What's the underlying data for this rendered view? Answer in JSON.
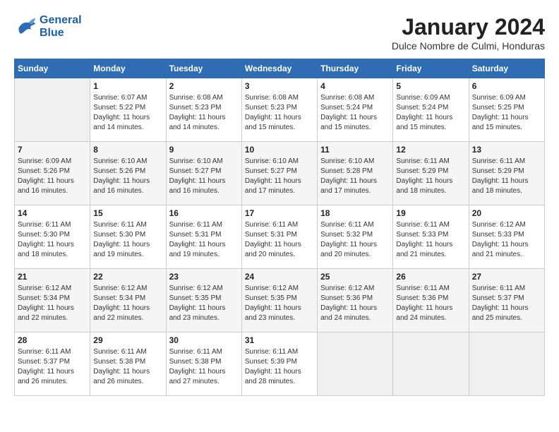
{
  "logo": {
    "line1": "General",
    "line2": "Blue"
  },
  "title": "January 2024",
  "location": "Dulce Nombre de Culmi, Honduras",
  "days_of_week": [
    "Sunday",
    "Monday",
    "Tuesday",
    "Wednesday",
    "Thursday",
    "Friday",
    "Saturday"
  ],
  "weeks": [
    [
      null,
      {
        "num": "1",
        "sunrise": "6:07 AM",
        "sunset": "5:22 PM",
        "daylight": "11 hours and 14 minutes."
      },
      {
        "num": "2",
        "sunrise": "6:08 AM",
        "sunset": "5:23 PM",
        "daylight": "11 hours and 14 minutes."
      },
      {
        "num": "3",
        "sunrise": "6:08 AM",
        "sunset": "5:23 PM",
        "daylight": "11 hours and 15 minutes."
      },
      {
        "num": "4",
        "sunrise": "6:08 AM",
        "sunset": "5:24 PM",
        "daylight": "11 hours and 15 minutes."
      },
      {
        "num": "5",
        "sunrise": "6:09 AM",
        "sunset": "5:24 PM",
        "daylight": "11 hours and 15 minutes."
      },
      {
        "num": "6",
        "sunrise": "6:09 AM",
        "sunset": "5:25 PM",
        "daylight": "11 hours and 15 minutes."
      }
    ],
    [
      {
        "num": "7",
        "sunrise": "6:09 AM",
        "sunset": "5:26 PM",
        "daylight": "11 hours and 16 minutes."
      },
      {
        "num": "8",
        "sunrise": "6:10 AM",
        "sunset": "5:26 PM",
        "daylight": "11 hours and 16 minutes."
      },
      {
        "num": "9",
        "sunrise": "6:10 AM",
        "sunset": "5:27 PM",
        "daylight": "11 hours and 16 minutes."
      },
      {
        "num": "10",
        "sunrise": "6:10 AM",
        "sunset": "5:27 PM",
        "daylight": "11 hours and 17 minutes."
      },
      {
        "num": "11",
        "sunrise": "6:10 AM",
        "sunset": "5:28 PM",
        "daylight": "11 hours and 17 minutes."
      },
      {
        "num": "12",
        "sunrise": "6:11 AM",
        "sunset": "5:29 PM",
        "daylight": "11 hours and 18 minutes."
      },
      {
        "num": "13",
        "sunrise": "6:11 AM",
        "sunset": "5:29 PM",
        "daylight": "11 hours and 18 minutes."
      }
    ],
    [
      {
        "num": "14",
        "sunrise": "6:11 AM",
        "sunset": "5:30 PM",
        "daylight": "11 hours and 18 minutes."
      },
      {
        "num": "15",
        "sunrise": "6:11 AM",
        "sunset": "5:30 PM",
        "daylight": "11 hours and 19 minutes."
      },
      {
        "num": "16",
        "sunrise": "6:11 AM",
        "sunset": "5:31 PM",
        "daylight": "11 hours and 19 minutes."
      },
      {
        "num": "17",
        "sunrise": "6:11 AM",
        "sunset": "5:31 PM",
        "daylight": "11 hours and 20 minutes."
      },
      {
        "num": "18",
        "sunrise": "6:11 AM",
        "sunset": "5:32 PM",
        "daylight": "11 hours and 20 minutes."
      },
      {
        "num": "19",
        "sunrise": "6:11 AM",
        "sunset": "5:33 PM",
        "daylight": "11 hours and 21 minutes."
      },
      {
        "num": "20",
        "sunrise": "6:12 AM",
        "sunset": "5:33 PM",
        "daylight": "11 hours and 21 minutes."
      }
    ],
    [
      {
        "num": "21",
        "sunrise": "6:12 AM",
        "sunset": "5:34 PM",
        "daylight": "11 hours and 22 minutes."
      },
      {
        "num": "22",
        "sunrise": "6:12 AM",
        "sunset": "5:34 PM",
        "daylight": "11 hours and 22 minutes."
      },
      {
        "num": "23",
        "sunrise": "6:12 AM",
        "sunset": "5:35 PM",
        "daylight": "11 hours and 23 minutes."
      },
      {
        "num": "24",
        "sunrise": "6:12 AM",
        "sunset": "5:35 PM",
        "daylight": "11 hours and 23 minutes."
      },
      {
        "num": "25",
        "sunrise": "6:12 AM",
        "sunset": "5:36 PM",
        "daylight": "11 hours and 24 minutes."
      },
      {
        "num": "26",
        "sunrise": "6:11 AM",
        "sunset": "5:36 PM",
        "daylight": "11 hours and 24 minutes."
      },
      {
        "num": "27",
        "sunrise": "6:11 AM",
        "sunset": "5:37 PM",
        "daylight": "11 hours and 25 minutes."
      }
    ],
    [
      {
        "num": "28",
        "sunrise": "6:11 AM",
        "sunset": "5:37 PM",
        "daylight": "11 hours and 26 minutes."
      },
      {
        "num": "29",
        "sunrise": "6:11 AM",
        "sunset": "5:38 PM",
        "daylight": "11 hours and 26 minutes."
      },
      {
        "num": "30",
        "sunrise": "6:11 AM",
        "sunset": "5:38 PM",
        "daylight": "11 hours and 27 minutes."
      },
      {
        "num": "31",
        "sunrise": "6:11 AM",
        "sunset": "5:39 PM",
        "daylight": "11 hours and 28 minutes."
      },
      null,
      null,
      null
    ]
  ]
}
